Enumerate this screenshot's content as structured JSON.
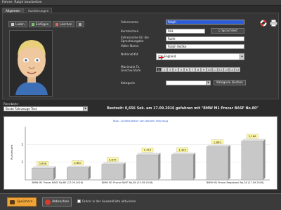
{
  "window": {
    "title": "Fahrer: Ralph bearbeiten"
  },
  "tabs": [
    {
      "label": "Allgemein",
      "active": true
    },
    {
      "label": "Ausfahrungen",
      "active": false
    }
  ],
  "image_toolbar": {
    "load_label": "Laden",
    "paste_label": "Einfügen",
    "delete_label": "Löschen"
  },
  "form": {
    "fahrername_label": "Fahrername",
    "fahrername_value": "Ralph",
    "kuerzel_label": "Kurzzeichen",
    "kuerzel_value": "RAL",
    "sprachausgabe_label": "Fahrername für die Sprachausgabe",
    "sprachausgabe_value": "Ralfe",
    "voller_name_label": "Voller Name",
    "voller_name_value": "Ralph Kottke",
    "nationalitaet_label": "Nationalität",
    "nationalitaet_value": "England",
    "max_speed_label": "Maximale Fz. Geschw.Stufe",
    "speed_levels": [
      "1",
      "2",
      "3",
      "4",
      "5",
      "6",
      "7",
      "8",
      "9",
      "10",
      "11",
      "12",
      "13",
      "14",
      "15"
    ],
    "kategorie_label": "Kategorie",
    "kategorie_value": ""
  },
  "buttons": {
    "sprachtest": "Sprachtest",
    "kategorie_loeschen": "Kategorie löschen"
  },
  "track": {
    "label": "Rennbahn",
    "value": "Beste Fahrzeuge Test"
  },
  "best_time": "Bestzeit: 0,656 Sek. am 17.09.2016 gefahren mit \"BMW M1 Procar BASF No.80\"",
  "chart_data": {
    "type": "bar",
    "title": "Max. 10 Bestzeiten von diesem Fahrzeug",
    "ylabel": "Rundenzeit",
    "xlabel": "",
    "ylim": [
      0,
      3
    ],
    "yticks": [
      1,
      2
    ],
    "categories": [
      "BMW M1 Procar BASF No.80 (17.09.2016)",
      "BMW M1 Procar BASF No.80 (15.09.2016)",
      "BMW M1 Procar Regazzoni No.28 (17.09.2016)"
    ],
    "values": [
      0.656,
      0.687,
      0.875,
      1.412,
      1.423,
      1.862,
      2.186
    ],
    "value_labels": [
      "0,656",
      "0,687",
      "0,875",
      "1,412",
      "1,423",
      "1,862",
      "2,186"
    ],
    "category_positions": [
      0,
      2,
      5
    ],
    "grid": true,
    "colors": {
      "bar": "#c8c8c8",
      "bar_side": "#8e8e8e",
      "label_bg": "#fff8a6"
    }
  },
  "footer": {
    "save_label": "Speichern",
    "cancel_label": "Abbrechen",
    "checkbox_label": "Fahrer in der Auswahlliste aktivieren"
  },
  "icons": {
    "lifebuoy": "lifebuoy-icon",
    "printer": "printer-icon"
  },
  "colors": {
    "accent": "#f0a437",
    "selection": "#2b5bd6",
    "link": "#2d5fd1"
  }
}
